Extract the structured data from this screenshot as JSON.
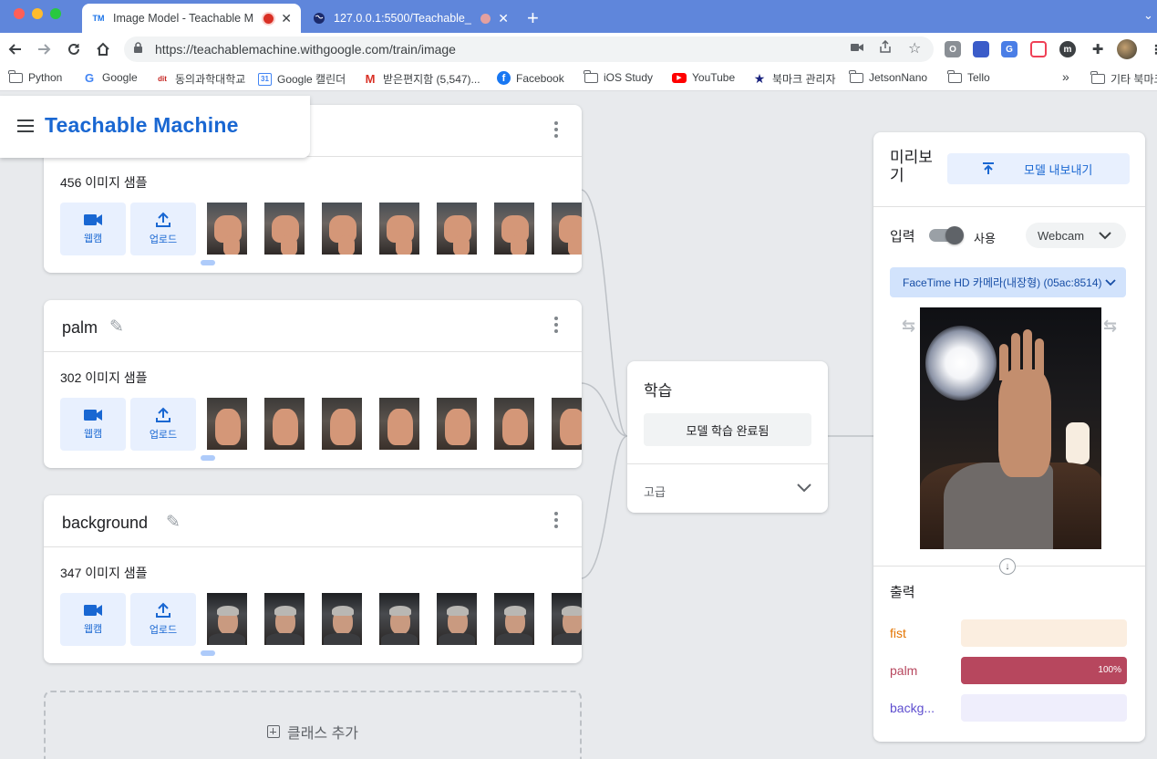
{
  "browser": {
    "tabs": [
      {
        "title": "Image Model - Teachable M",
        "favicon": "TM",
        "recording": true
      },
      {
        "title": "127.0.0.1:5500/Teachable_",
        "favicon": "globe-icon",
        "recording": true
      }
    ],
    "url": "https://teachablemachine.withgoogle.com/train/image",
    "bookmarks": [
      {
        "label": "Python",
        "icon": "folder-icon"
      },
      {
        "label": "Google",
        "icon": "google-icon"
      },
      {
        "label": "동의과학대학교",
        "icon": "dit-icon"
      },
      {
        "label": "Google 캘린더",
        "icon": "calendar-icon"
      },
      {
        "label": "받은편지함 (5,547)...",
        "icon": "gmail-icon"
      },
      {
        "label": "Facebook",
        "icon": "facebook-icon"
      },
      {
        "label": "iOS Study",
        "icon": "folder-icon"
      },
      {
        "label": "YouTube",
        "icon": "youtube-icon"
      },
      {
        "label": "북마크 관리자",
        "icon": "star-icon"
      },
      {
        "label": "JetsonNano",
        "icon": "folder-icon"
      },
      {
        "label": "Tello",
        "icon": "folder-icon"
      }
    ],
    "more_bookmarks": "»",
    "other_bookmarks": "기타 북마크"
  },
  "app": {
    "brand": "Teachable Machine"
  },
  "classes": [
    {
      "name": "",
      "samples": "456 이미지 샘플",
      "thumb_kind": "fist"
    },
    {
      "name": "palm",
      "samples": "302 이미지 샘플",
      "thumb_kind": "palm"
    },
    {
      "name": "background",
      "samples": "347 이미지 샘플",
      "thumb_kind": "bg"
    }
  ],
  "class_buttons": {
    "webcam": "웹캠",
    "upload": "업로드"
  },
  "add_class": "클래스 추가",
  "training": {
    "title": "학습",
    "button": "모델 학습 완료됨",
    "advanced": "고급"
  },
  "preview": {
    "title": "미리보기",
    "export_button": "모델 내보내기",
    "input_label": "입력",
    "toggle_label": "사용",
    "toggle_on": true,
    "source": "Webcam",
    "camera": "FaceTime HD 카메라(내장형) (05ac:8514)",
    "output_label": "출력",
    "outputs": [
      {
        "label": "fist",
        "value": 0,
        "color": "#e37400",
        "track": "#fbeee0"
      },
      {
        "label": "palm",
        "value": 1.0,
        "value_text": "100%",
        "color": "#b7475e",
        "track": "#f8e5ea"
      },
      {
        "label": "backg...",
        "value": 0,
        "color": "#5e4ecf",
        "track": "#efeefc"
      }
    ]
  }
}
